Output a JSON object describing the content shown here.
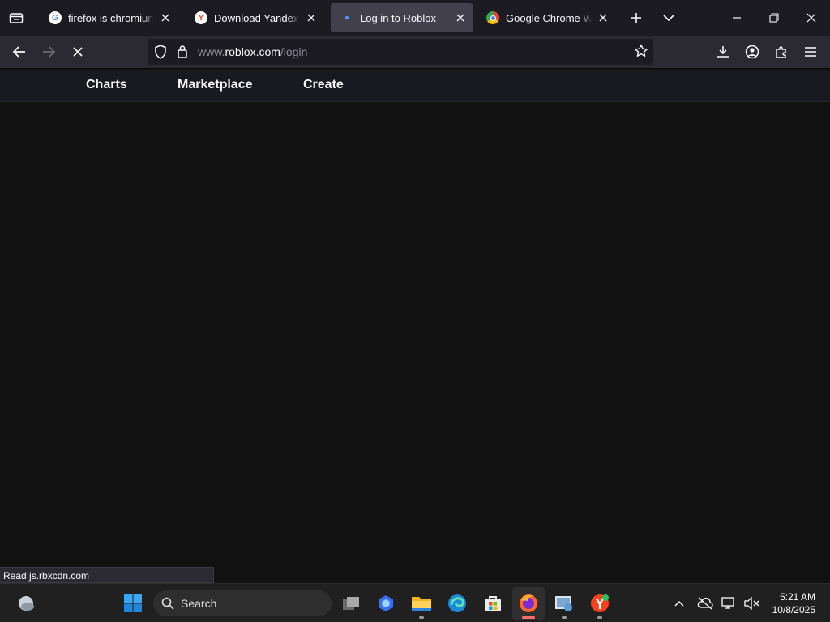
{
  "tabs": [
    {
      "title": "firefox is chromium bas",
      "favicon": "google-g-icon"
    },
    {
      "title": "Download Yandex Brow",
      "favicon": "yandex-icon"
    },
    {
      "title": "Log in to Roblox",
      "favicon": "loading-dot-icon"
    },
    {
      "title": "Google Chrome Web B",
      "favicon": "chrome-icon"
    }
  ],
  "url": {
    "prefix": "www.",
    "host": "roblox.com",
    "path": "/login"
  },
  "site_nav": {
    "items": [
      "Charts",
      "Marketplace",
      "Create"
    ]
  },
  "status_text": "Read js.rbxcdn.com",
  "taskbar": {
    "search_label": "Search",
    "time": "5:21 AM",
    "date": "10/8/2025"
  },
  "colors": {
    "accent": "#ff6c6c",
    "active_tab": "#42414d",
    "page_background": "#111112"
  }
}
